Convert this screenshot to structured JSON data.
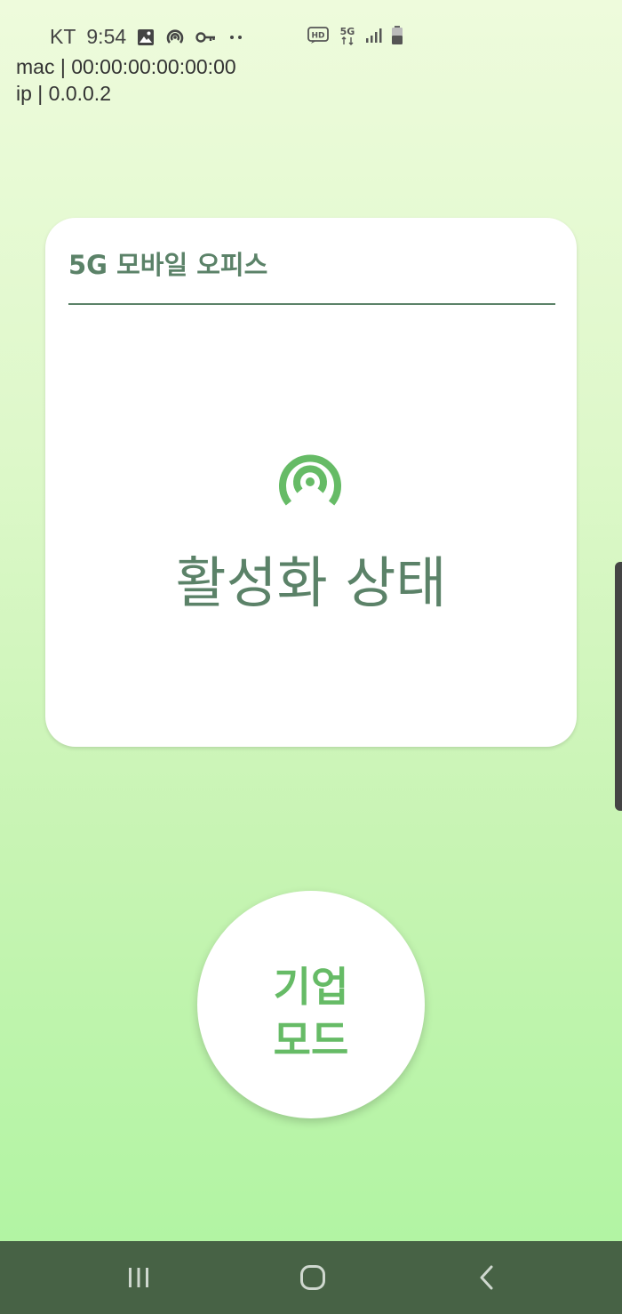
{
  "status_bar": {
    "carrier": "KT",
    "time": "9:54",
    "network": "5G",
    "hd": "HD"
  },
  "device_info": {
    "mac": "mac | 00:00:00:00:00:00",
    "ip": "ip | 0.0.0.2"
  },
  "card": {
    "title": "5G 모바일 오피스",
    "status": "활성화 상태",
    "icon": "hotspot-icon"
  },
  "mode_button": {
    "line1": "기업",
    "line2": "모드"
  },
  "colors": {
    "accent_green": "#66bb66",
    "text_green": "#5b8268",
    "nav_bar": "#476245"
  }
}
